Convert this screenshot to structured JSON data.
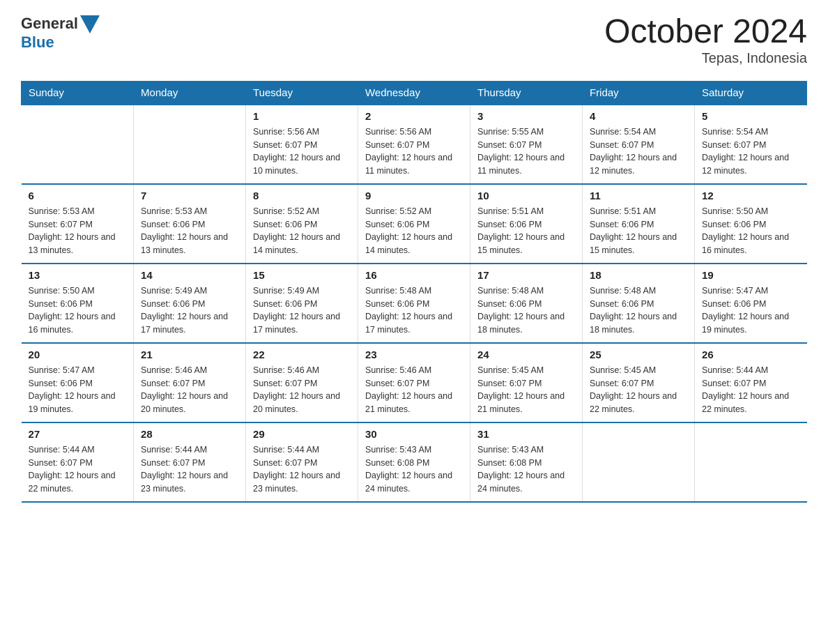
{
  "logo": {
    "general": "General",
    "blue": "Blue"
  },
  "title": "October 2024",
  "subtitle": "Tepas, Indonesia",
  "days_header": [
    "Sunday",
    "Monday",
    "Tuesday",
    "Wednesday",
    "Thursday",
    "Friday",
    "Saturday"
  ],
  "weeks": [
    [
      {
        "day": "",
        "sunrise": "",
        "sunset": "",
        "daylight": ""
      },
      {
        "day": "",
        "sunrise": "",
        "sunset": "",
        "daylight": ""
      },
      {
        "day": "1",
        "sunrise": "Sunrise: 5:56 AM",
        "sunset": "Sunset: 6:07 PM",
        "daylight": "Daylight: 12 hours and 10 minutes."
      },
      {
        "day": "2",
        "sunrise": "Sunrise: 5:56 AM",
        "sunset": "Sunset: 6:07 PM",
        "daylight": "Daylight: 12 hours and 11 minutes."
      },
      {
        "day": "3",
        "sunrise": "Sunrise: 5:55 AM",
        "sunset": "Sunset: 6:07 PM",
        "daylight": "Daylight: 12 hours and 11 minutes."
      },
      {
        "day": "4",
        "sunrise": "Sunrise: 5:54 AM",
        "sunset": "Sunset: 6:07 PM",
        "daylight": "Daylight: 12 hours and 12 minutes."
      },
      {
        "day": "5",
        "sunrise": "Sunrise: 5:54 AM",
        "sunset": "Sunset: 6:07 PM",
        "daylight": "Daylight: 12 hours and 12 minutes."
      }
    ],
    [
      {
        "day": "6",
        "sunrise": "Sunrise: 5:53 AM",
        "sunset": "Sunset: 6:07 PM",
        "daylight": "Daylight: 12 hours and 13 minutes."
      },
      {
        "day": "7",
        "sunrise": "Sunrise: 5:53 AM",
        "sunset": "Sunset: 6:06 PM",
        "daylight": "Daylight: 12 hours and 13 minutes."
      },
      {
        "day": "8",
        "sunrise": "Sunrise: 5:52 AM",
        "sunset": "Sunset: 6:06 PM",
        "daylight": "Daylight: 12 hours and 14 minutes."
      },
      {
        "day": "9",
        "sunrise": "Sunrise: 5:52 AM",
        "sunset": "Sunset: 6:06 PM",
        "daylight": "Daylight: 12 hours and 14 minutes."
      },
      {
        "day": "10",
        "sunrise": "Sunrise: 5:51 AM",
        "sunset": "Sunset: 6:06 PM",
        "daylight": "Daylight: 12 hours and 15 minutes."
      },
      {
        "day": "11",
        "sunrise": "Sunrise: 5:51 AM",
        "sunset": "Sunset: 6:06 PM",
        "daylight": "Daylight: 12 hours and 15 minutes."
      },
      {
        "day": "12",
        "sunrise": "Sunrise: 5:50 AM",
        "sunset": "Sunset: 6:06 PM",
        "daylight": "Daylight: 12 hours and 16 minutes."
      }
    ],
    [
      {
        "day": "13",
        "sunrise": "Sunrise: 5:50 AM",
        "sunset": "Sunset: 6:06 PM",
        "daylight": "Daylight: 12 hours and 16 minutes."
      },
      {
        "day": "14",
        "sunrise": "Sunrise: 5:49 AM",
        "sunset": "Sunset: 6:06 PM",
        "daylight": "Daylight: 12 hours and 17 minutes."
      },
      {
        "day": "15",
        "sunrise": "Sunrise: 5:49 AM",
        "sunset": "Sunset: 6:06 PM",
        "daylight": "Daylight: 12 hours and 17 minutes."
      },
      {
        "day": "16",
        "sunrise": "Sunrise: 5:48 AM",
        "sunset": "Sunset: 6:06 PM",
        "daylight": "Daylight: 12 hours and 17 minutes."
      },
      {
        "day": "17",
        "sunrise": "Sunrise: 5:48 AM",
        "sunset": "Sunset: 6:06 PM",
        "daylight": "Daylight: 12 hours and 18 minutes."
      },
      {
        "day": "18",
        "sunrise": "Sunrise: 5:48 AM",
        "sunset": "Sunset: 6:06 PM",
        "daylight": "Daylight: 12 hours and 18 minutes."
      },
      {
        "day": "19",
        "sunrise": "Sunrise: 5:47 AM",
        "sunset": "Sunset: 6:06 PM",
        "daylight": "Daylight: 12 hours and 19 minutes."
      }
    ],
    [
      {
        "day": "20",
        "sunrise": "Sunrise: 5:47 AM",
        "sunset": "Sunset: 6:06 PM",
        "daylight": "Daylight: 12 hours and 19 minutes."
      },
      {
        "day": "21",
        "sunrise": "Sunrise: 5:46 AM",
        "sunset": "Sunset: 6:07 PM",
        "daylight": "Daylight: 12 hours and 20 minutes."
      },
      {
        "day": "22",
        "sunrise": "Sunrise: 5:46 AM",
        "sunset": "Sunset: 6:07 PM",
        "daylight": "Daylight: 12 hours and 20 minutes."
      },
      {
        "day": "23",
        "sunrise": "Sunrise: 5:46 AM",
        "sunset": "Sunset: 6:07 PM",
        "daylight": "Daylight: 12 hours and 21 minutes."
      },
      {
        "day": "24",
        "sunrise": "Sunrise: 5:45 AM",
        "sunset": "Sunset: 6:07 PM",
        "daylight": "Daylight: 12 hours and 21 minutes."
      },
      {
        "day": "25",
        "sunrise": "Sunrise: 5:45 AM",
        "sunset": "Sunset: 6:07 PM",
        "daylight": "Daylight: 12 hours and 22 minutes."
      },
      {
        "day": "26",
        "sunrise": "Sunrise: 5:44 AM",
        "sunset": "Sunset: 6:07 PM",
        "daylight": "Daylight: 12 hours and 22 minutes."
      }
    ],
    [
      {
        "day": "27",
        "sunrise": "Sunrise: 5:44 AM",
        "sunset": "Sunset: 6:07 PM",
        "daylight": "Daylight: 12 hours and 22 minutes."
      },
      {
        "day": "28",
        "sunrise": "Sunrise: 5:44 AM",
        "sunset": "Sunset: 6:07 PM",
        "daylight": "Daylight: 12 hours and 23 minutes."
      },
      {
        "day": "29",
        "sunrise": "Sunrise: 5:44 AM",
        "sunset": "Sunset: 6:07 PM",
        "daylight": "Daylight: 12 hours and 23 minutes."
      },
      {
        "day": "30",
        "sunrise": "Sunrise: 5:43 AM",
        "sunset": "Sunset: 6:08 PM",
        "daylight": "Daylight: 12 hours and 24 minutes."
      },
      {
        "day": "31",
        "sunrise": "Sunrise: 5:43 AM",
        "sunset": "Sunset: 6:08 PM",
        "daylight": "Daylight: 12 hours and 24 minutes."
      },
      {
        "day": "",
        "sunrise": "",
        "sunset": "",
        "daylight": ""
      },
      {
        "day": "",
        "sunrise": "",
        "sunset": "",
        "daylight": ""
      }
    ]
  ]
}
